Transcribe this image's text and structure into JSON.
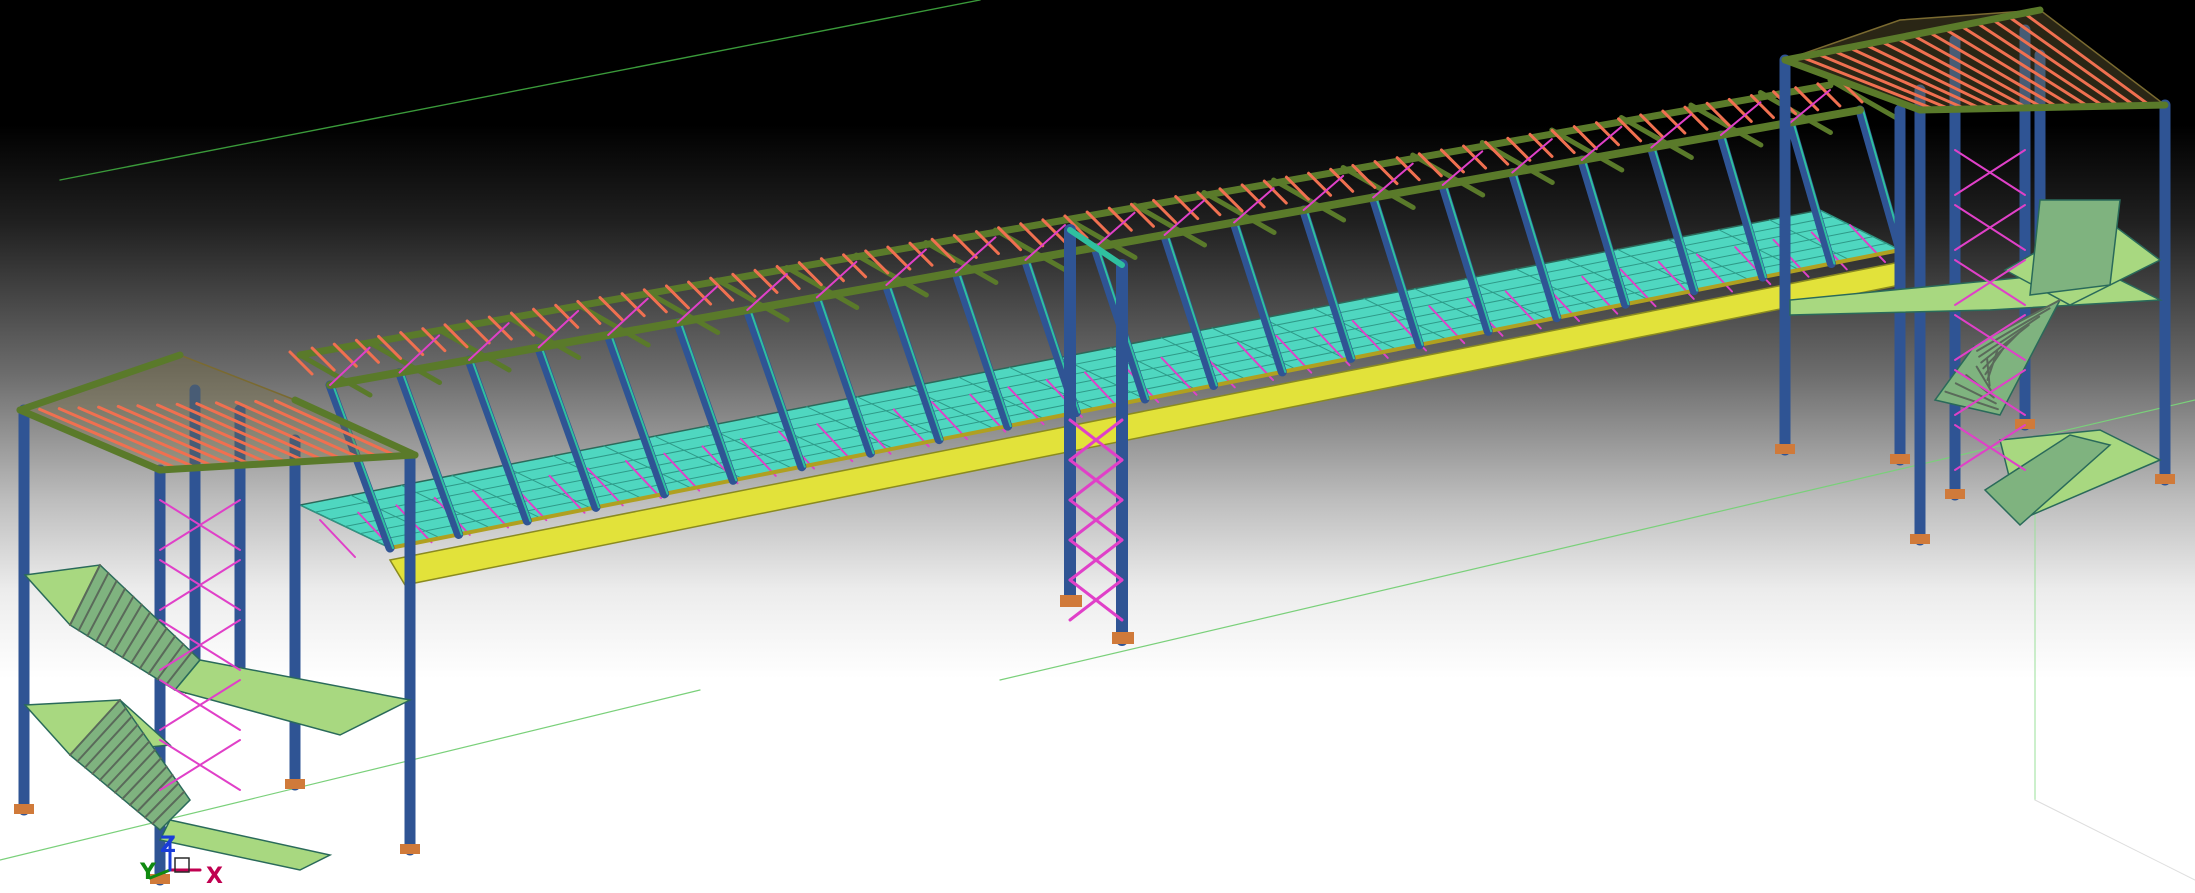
{
  "viewport": {
    "name": "3d-model-viewport",
    "background_top": "#000000",
    "background_bottom": "#ffffff"
  },
  "axis_triad": {
    "x_label": "X",
    "y_label": "Y",
    "z_label": "Z",
    "x_color": "#c00050",
    "y_color": "#108a10",
    "z_color": "#1a3cd8"
  },
  "model": {
    "description_icon": "steel-walkway-bridge-model",
    "member_colors": {
      "column": "#2f5494",
      "beam": "#5a7a2a",
      "deck_grating": "#4fd7c0",
      "handrail": "#e2e23a",
      "bracing": "#e040c8",
      "purlin": "#f07050",
      "base_plate": "#d07a3a",
      "stair_tread": "#a8d880"
    }
  }
}
